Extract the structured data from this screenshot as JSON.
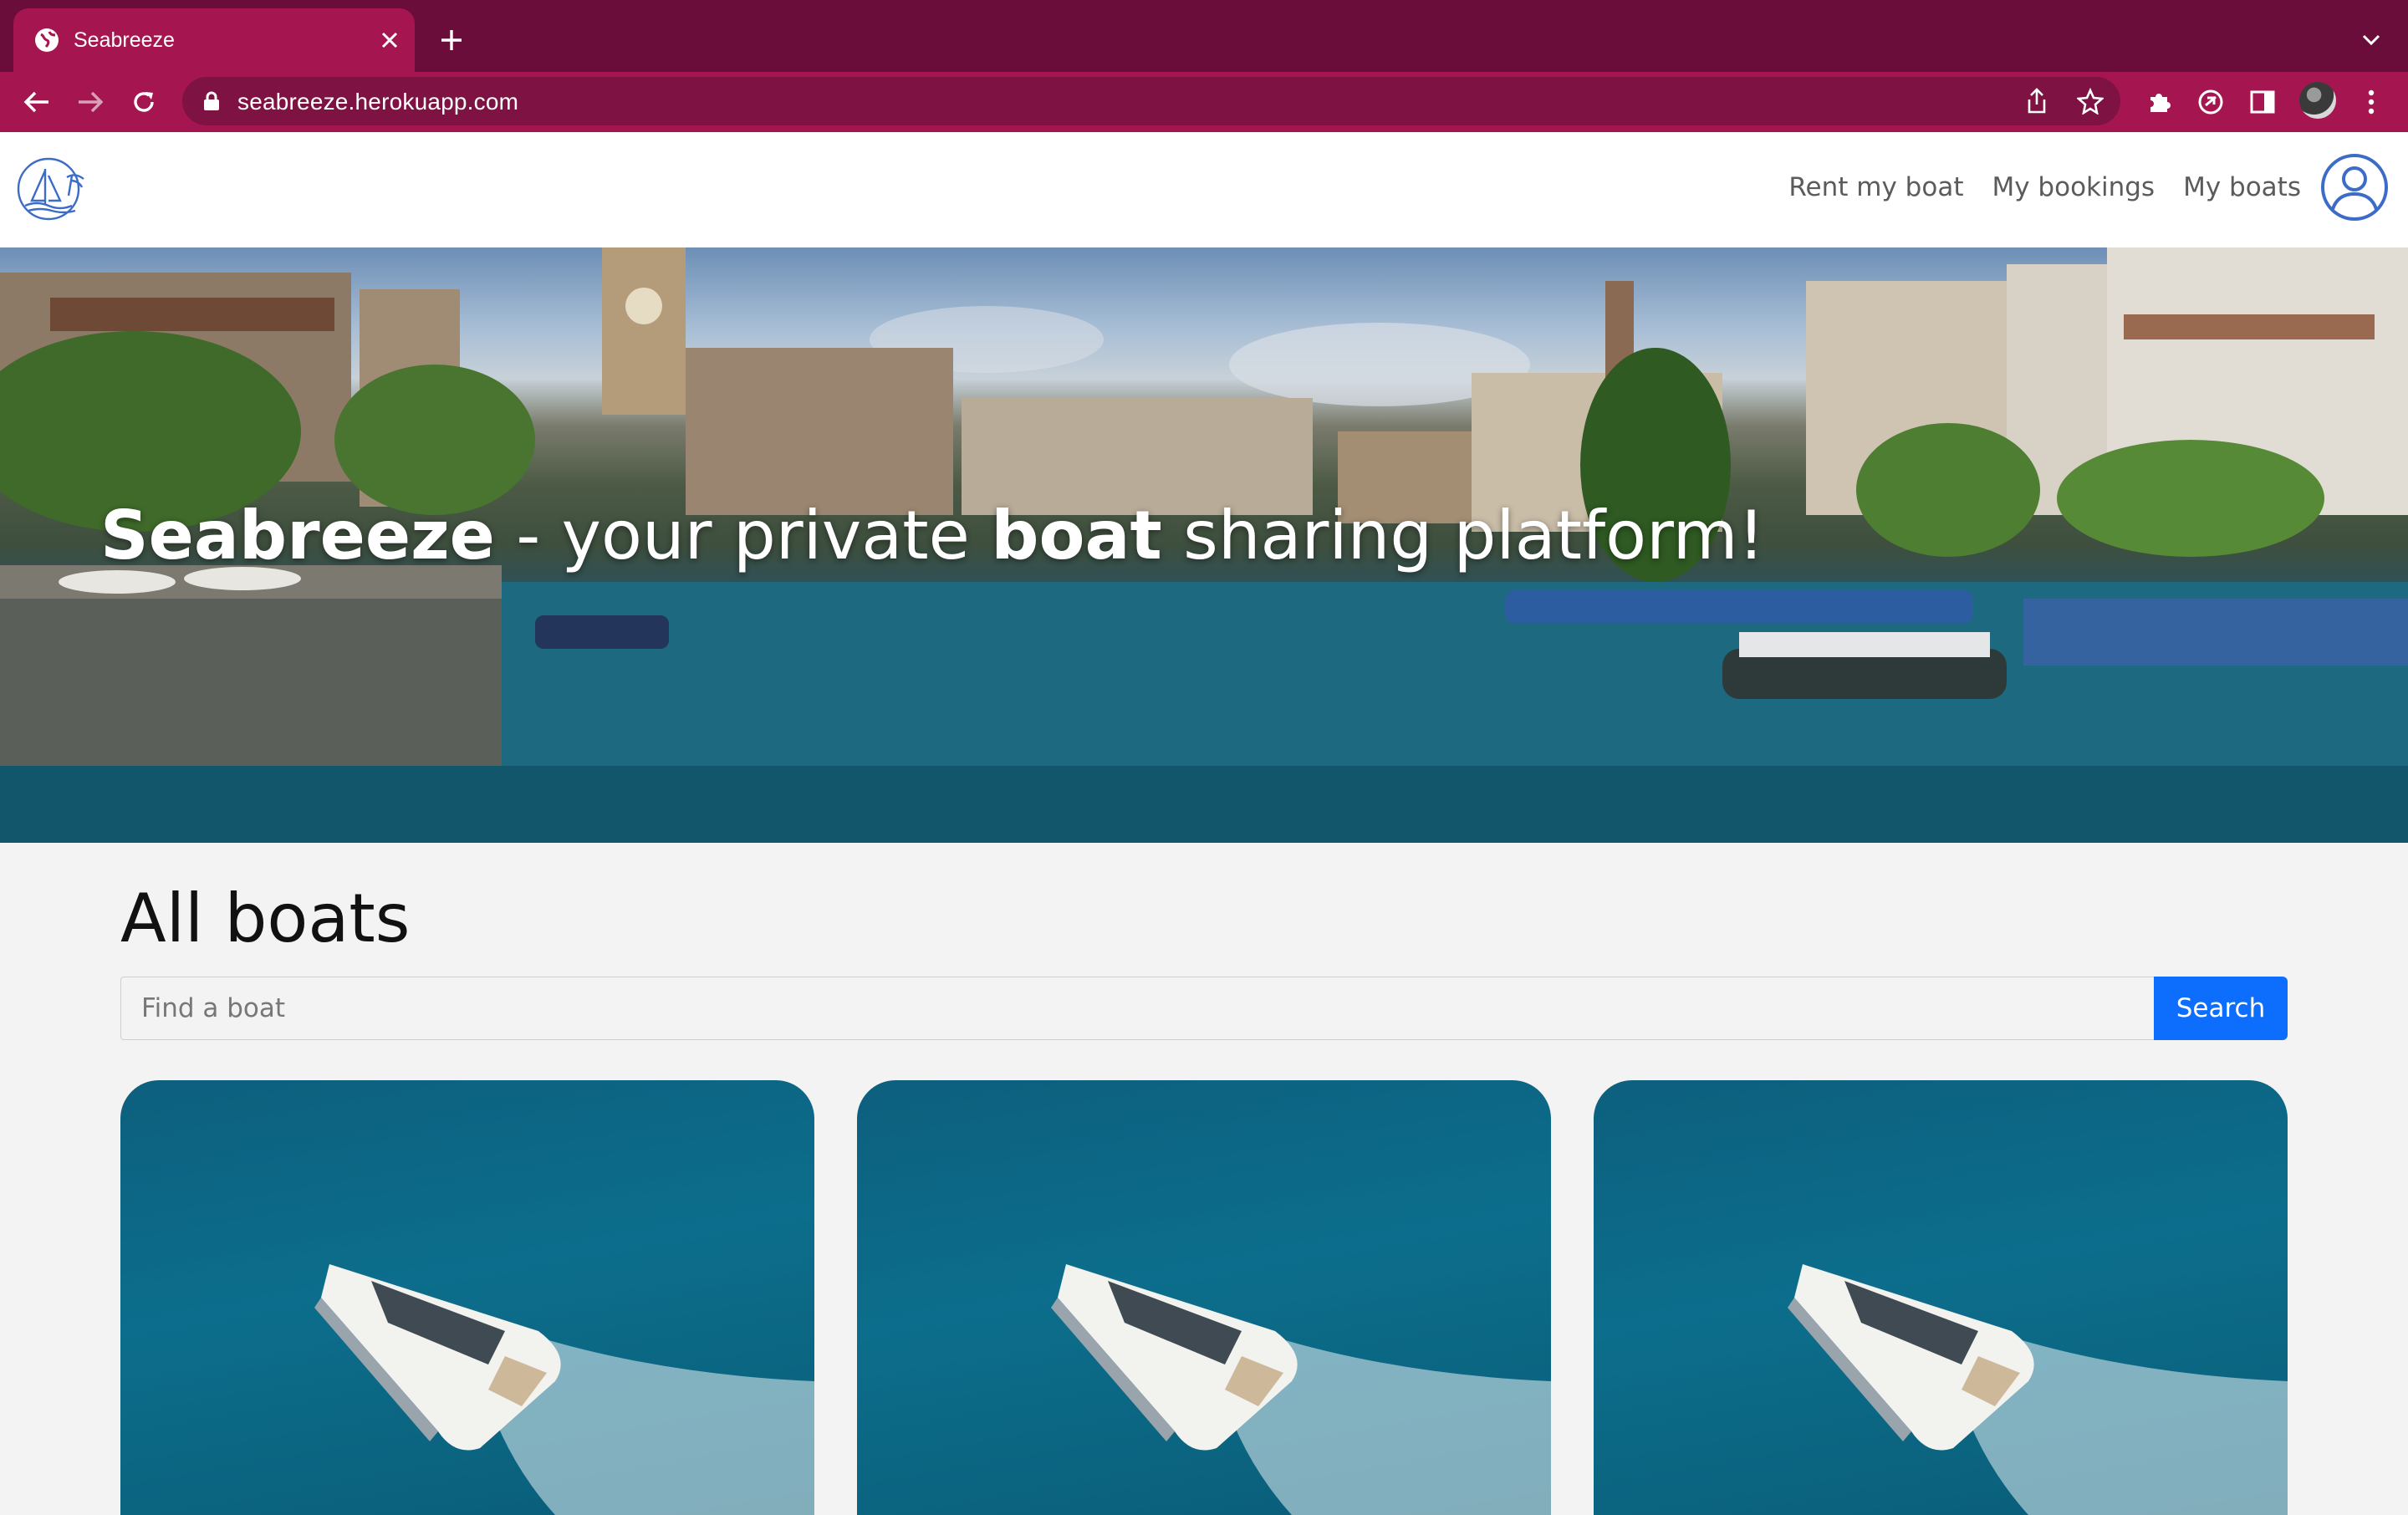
{
  "browser": {
    "tab_title": "Seabreeze",
    "url": "seabreeze.herokuapp.com"
  },
  "nav": {
    "links": [
      "Rent my boat",
      "My bookings",
      "My boats"
    ]
  },
  "hero": {
    "brand": "Seabreeze",
    "text1": " - your private ",
    "bold2": "boat",
    "text3": " sharing platform!"
  },
  "main": {
    "title": "All boats",
    "search": {
      "placeholder": "Find a boat",
      "button": "Search"
    },
    "cards": [
      {
        "image": "yacht-photo"
      },
      {
        "image": "yacht-photo"
      },
      {
        "image": "yacht-photo"
      }
    ]
  },
  "colors": {
    "chrome_dark": "#6a0d3a",
    "chrome_active": "#a5154f",
    "search_button": "#0d6efd"
  }
}
